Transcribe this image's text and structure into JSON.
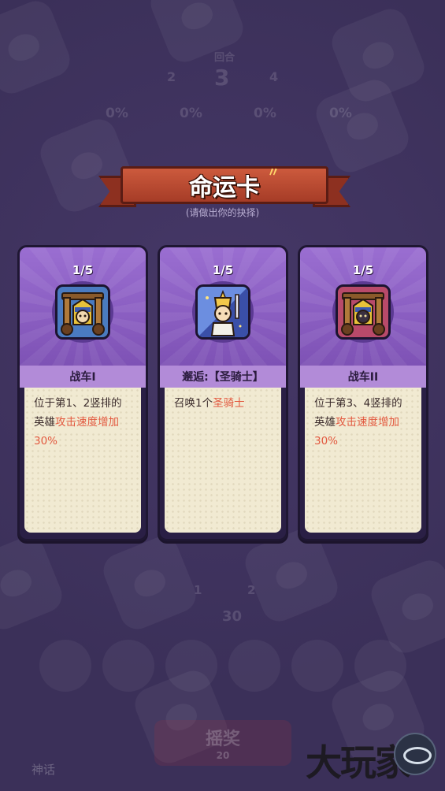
{
  "background_hud": {
    "round_label": "回合",
    "round_current": "3",
    "round_prev": "2",
    "round_next": "4",
    "stats": [
      "0%",
      "0%",
      "0%",
      "0%"
    ],
    "bottom_numbers": [
      "1",
      "2"
    ],
    "coins": "30",
    "spin_label": "摇奖",
    "spin_cost": "20",
    "chat_label": "神话"
  },
  "modal": {
    "title": "命运卡",
    "subtitle": "(请做出你的抉择)"
  },
  "cards": [
    {
      "count": "1/5",
      "icon": "chariot-sphinx-icon",
      "name": "战车I",
      "desc_plain_1": "位于第1、2竖排的英雄",
      "desc_highlight": "攻击速度增加30%",
      "desc_plain_2": ""
    },
    {
      "count": "1/5",
      "icon": "paladin-icon",
      "name": "邂逅:【圣骑士】",
      "desc_plain_1": "召唤1个",
      "desc_highlight": "圣骑士",
      "desc_plain_2": ""
    },
    {
      "count": "1/5",
      "icon": "chariot-anubis-icon",
      "name": "战车II",
      "desc_plain_1": "位于第3、4竖排的英雄",
      "desc_highlight": "攻击速度增加30%",
      "desc_plain_2": ""
    }
  ],
  "watermark": {
    "text": "大玩家"
  },
  "colors": {
    "background": "#3b3059",
    "card_purple": "#8a5ec4",
    "banner_red": "#b84a30",
    "highlight": "#e2583e",
    "desc_bg": "#f1ead2"
  }
}
